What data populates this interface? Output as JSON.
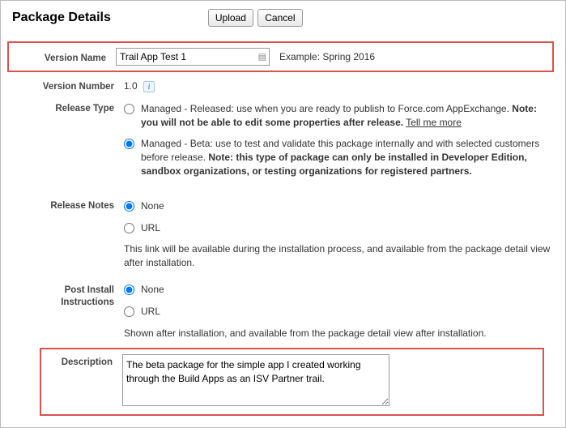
{
  "header": {
    "title": "Package Details",
    "upload": "Upload",
    "cancel": "Cancel"
  },
  "versionName": {
    "label": "Version Name",
    "value": "Trail App Test 1",
    "example": "Example: Spring 2016"
  },
  "versionNumber": {
    "label": "Version Number",
    "value": "1.0"
  },
  "releaseType": {
    "label": "Release Type",
    "released_pre": "Managed - Released: use when you are ready to publish to Force.com AppExchange. ",
    "released_bold": "Note: you will not be able to edit some properties after release.",
    "released_link": "Tell me more",
    "beta_pre": "Managed - Beta: use to test and validate this package internally and with selected customers before release. ",
    "beta_bold": "Note: this type of package can only be installed in Developer Edition, sandbox organizations, or testing organizations for registered partners."
  },
  "releaseNotes": {
    "label": "Release Notes",
    "none": "None",
    "url": "URL",
    "help": "This link will be available during the installation process, and available from the package detail view after installation."
  },
  "postInstall": {
    "label": "Post Install Instructions",
    "none": "None",
    "url": "URL",
    "help": "Shown after installation, and available from the package detail view after installation."
  },
  "description": {
    "label": "Description",
    "value": "The beta package for the simple app I created working through the Build Apps as an ISV Partner trail."
  }
}
